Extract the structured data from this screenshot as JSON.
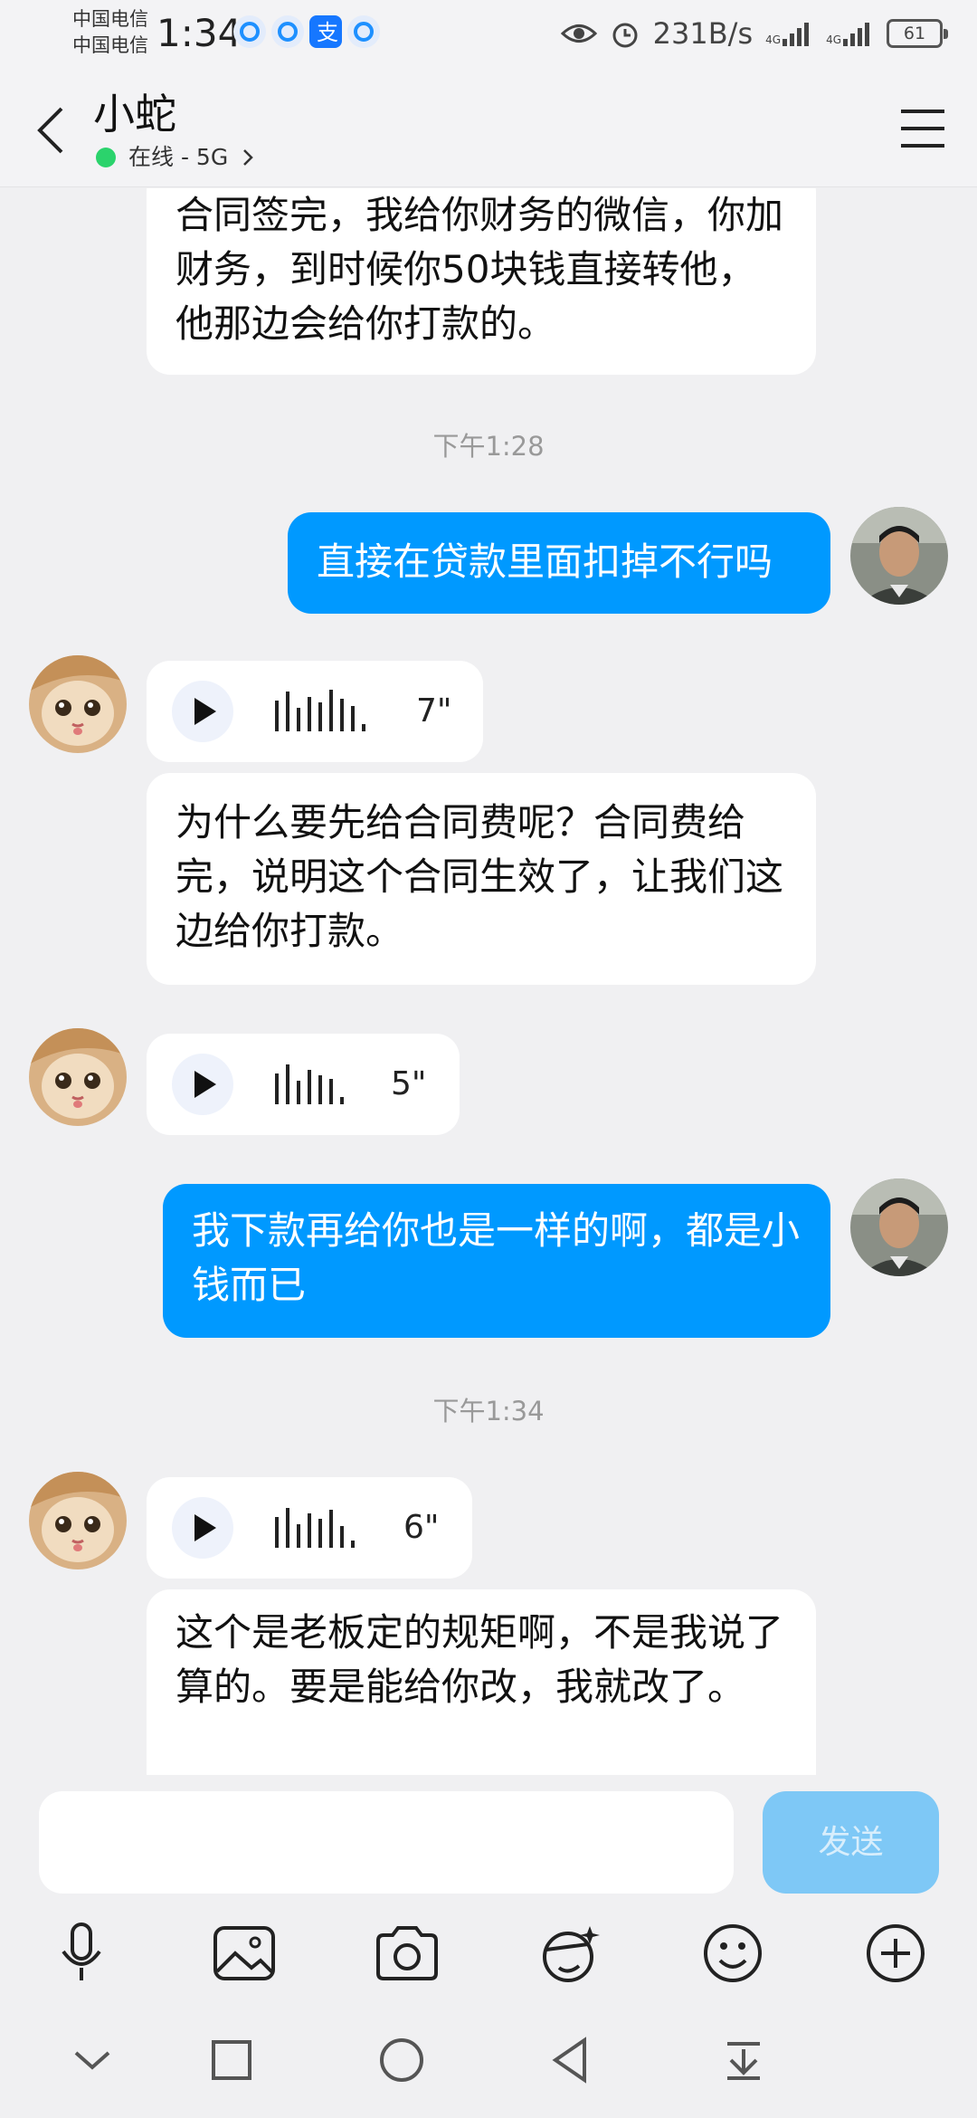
{
  "status_bar": {
    "carrier_1": "中国电信",
    "carrier_2": "中国电信",
    "time": "1:34",
    "net_speed": "231B/s",
    "signal_1": "4G",
    "signal_2": "4G",
    "battery": "61"
  },
  "header": {
    "title": "小蛇",
    "status": "在线 - 5G"
  },
  "messages": {
    "m1": "合同签完，我给你财务的微信，你加财务，到时候你50块钱直接转他，他那边会给你打款的。",
    "stamp1": "下午1:28",
    "m2": "直接在贷款里面扣掉不行吗",
    "v1": "7\"",
    "m3": "为什么要先给合同费呢？合同费给完，说明这个合同生效了，让我们这边给你打款。",
    "v2": "5\"",
    "m4": "我下款再给你也是一样的啊，都是小钱而已",
    "stamp2": "下午1:34",
    "v3": "6\"",
    "m5": "这个是老板定的规矩啊，不是我说了算的。要是能给你改，我就改了。"
  },
  "input": {
    "send_label": "发送"
  },
  "colors": {
    "outgoing_bubble": "#0099ff",
    "incoming_bubble": "#ffffff",
    "online_dot": "#2bd36c",
    "send_button": "#7ec8f6"
  }
}
